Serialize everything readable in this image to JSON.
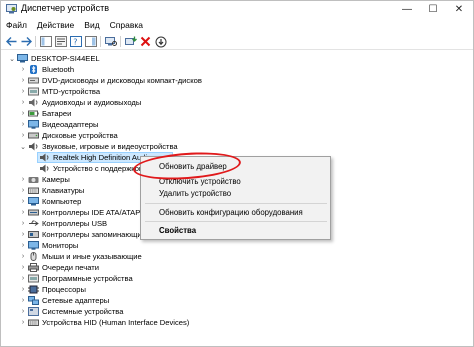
{
  "window": {
    "title": "Диспетчер устройств",
    "minimize": "—",
    "maximize": "☐",
    "close": "✕"
  },
  "menu": [
    "Файл",
    "Действие",
    "Вид",
    "Справка"
  ],
  "tree": {
    "root": "DESKTOP-SI44EEL",
    "items": [
      "Bluetooth",
      "DVD-дисководы и дисководы компакт-дисков",
      "MTD-устройства",
      "Аудиовходы и аудиовыходы",
      "Батареи",
      "Видеоадаптеры",
      "Дисковые устройства",
      "Звуковые, игровые и видеоустройства",
      "Realtek High Definition Audio",
      "Устройство с поддержкой",
      "Камеры",
      "Клавиатуры",
      "Компьютер",
      "Контроллеры IDE ATA/ATAPI",
      "Контроллеры USB",
      "Контроллеры запоминающих",
      "Мониторы",
      "Мыши и иные указывающие",
      "Очереди печати",
      "Программные устройства",
      "Процессоры",
      "Сетевые адаптеры",
      "Системные устройства",
      "Устройства HID (Human Interface Devices)"
    ]
  },
  "context_menu": {
    "update_driver": "Обновить драйвер",
    "disable_device": "Отключить устройство",
    "uninstall_device": "Удалить устройство",
    "scan_hardware": "Обновить конфигурацию оборудования",
    "properties": "Свойства"
  },
  "colors": {
    "selection": "#cce8ff",
    "annotation": "#e0191b"
  }
}
